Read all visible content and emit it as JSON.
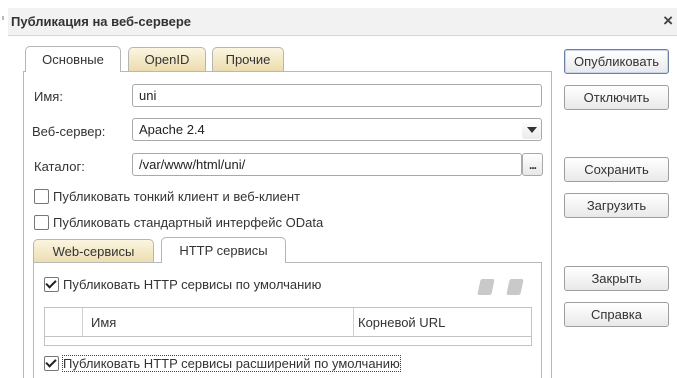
{
  "window": {
    "title": "Публикация на веб-сервере",
    "close_glyph": "×"
  },
  "tabs": [
    {
      "label": "Основные",
      "active": true
    },
    {
      "label": "OpenID",
      "active": false
    },
    {
      "label": "Прочие",
      "active": false
    }
  ],
  "form": {
    "name_label": "Имя:",
    "name_value": "uni",
    "server_label": "Веб-сервер:",
    "server_value": "Apache 2.4",
    "catalog_label": "Каталог:",
    "catalog_value": "/var/www/html/uni/",
    "browse_label": "...",
    "publish_thin_client": {
      "label": "Публиковать тонкий клиент и веб-клиент",
      "checked": false
    },
    "publish_odata": {
      "label": "Публиковать стандартный интерфейс OData",
      "checked": false
    }
  },
  "subtabs": [
    {
      "label": "Web-сервисы",
      "active": false
    },
    {
      "label": "HTTP сервисы",
      "active": true
    }
  ],
  "http": {
    "publish_default": {
      "label": "Публиковать HTTP сервисы по умолчанию",
      "checked": true
    },
    "table": {
      "columns": [
        "Имя",
        "Корневой URL"
      ],
      "rows": []
    },
    "publish_ext_default": {
      "label": "Публиковать HTTP сервисы расширений по умолчанию",
      "checked": true
    }
  },
  "buttons": {
    "publish": "Опубликовать",
    "disable": "Отключить",
    "save": "Сохранить",
    "load": "Загрузить",
    "close": "Закрыть",
    "help": "Справка"
  },
  "icons": {
    "close": "close-icon",
    "dropdown": "chevron-down-icon",
    "check": "check-icon",
    "add": "add-icon",
    "copy": "copy-icon"
  }
}
